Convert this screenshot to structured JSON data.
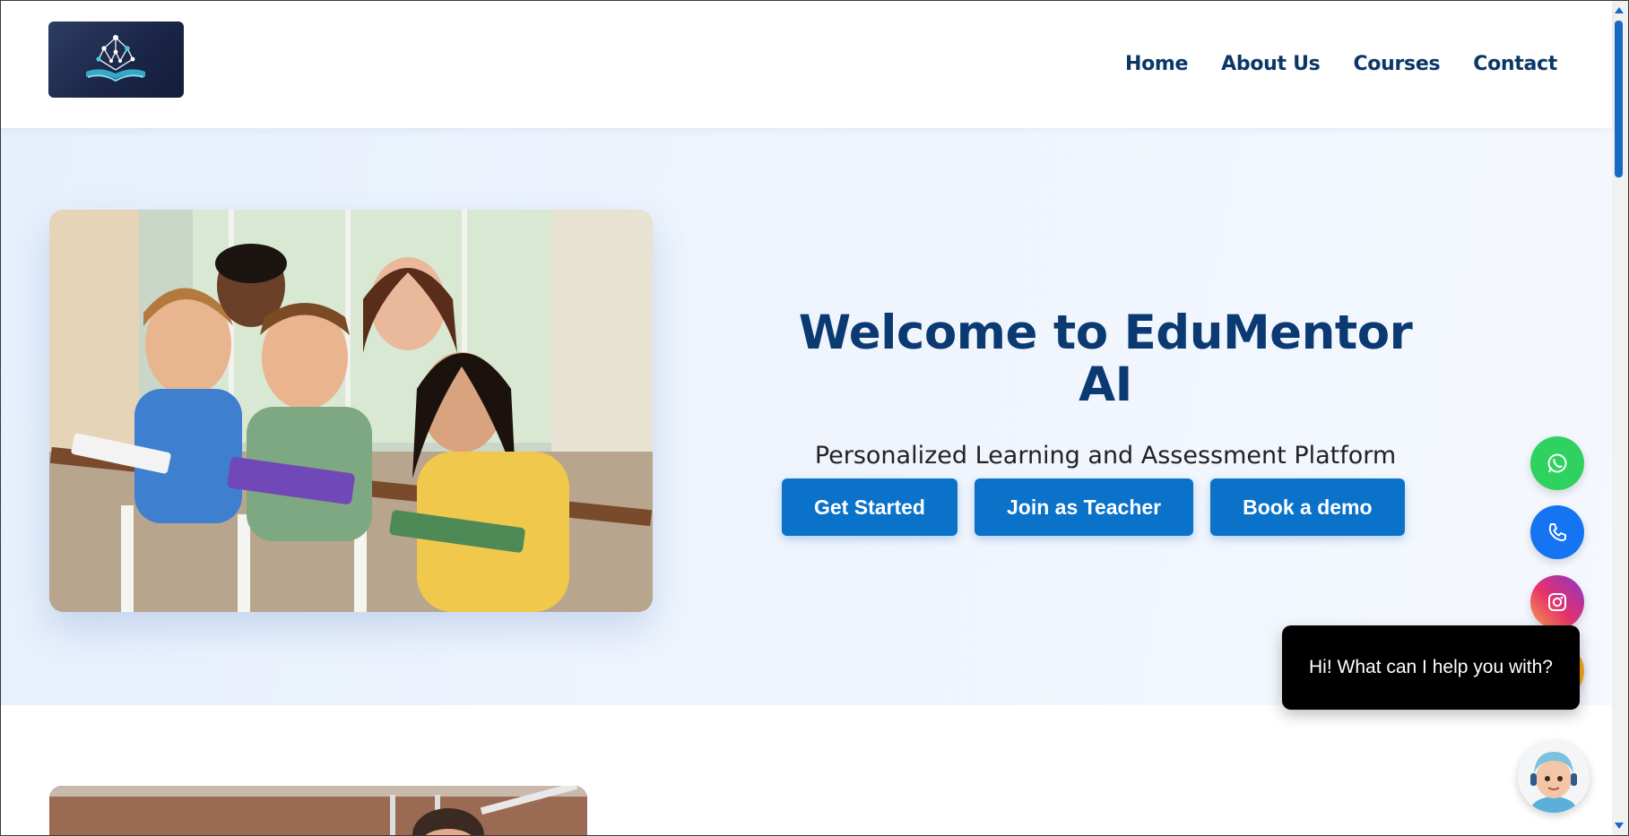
{
  "nav": {
    "items": [
      {
        "label": "Home"
      },
      {
        "label": "About Us"
      },
      {
        "label": "Courses"
      },
      {
        "label": "Contact"
      }
    ]
  },
  "hero": {
    "title": "Welcome to EduMentor AI",
    "subtitle": "Personalized Learning and Assessment Platform",
    "buttons": [
      {
        "label": "Get Started"
      },
      {
        "label": "Join as Teacher"
      },
      {
        "label": "Book a demo"
      }
    ]
  },
  "chat": {
    "message": "Hi! What can I help you with?"
  },
  "colors": {
    "nav_text": "#0b3768",
    "title": "#0b3a72",
    "button": "#0a72c9",
    "whatsapp": "#2fd25e",
    "phone": "#1474f2"
  },
  "icons": {
    "floating": [
      "whatsapp-icon",
      "phone-icon",
      "instagram-icon",
      "orange-icon"
    ],
    "avatar": "assistant-avatar"
  }
}
